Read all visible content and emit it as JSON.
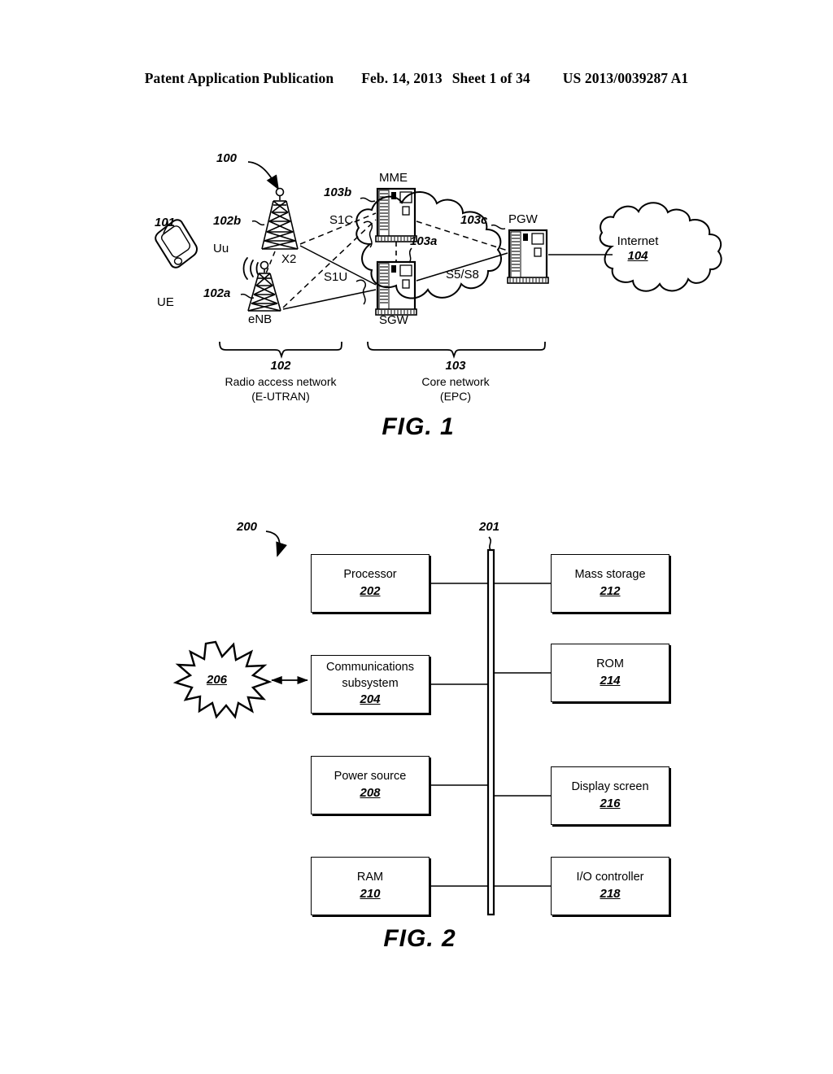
{
  "header": {
    "publication": "Patent Application Publication",
    "date": "Feb. 14, 2013",
    "sheet": "Sheet 1 of 34",
    "docnum": "US 2013/0039287 A1"
  },
  "fig1": {
    "caption": "FIG. 1",
    "system_ref": "100",
    "ue": {
      "ref": "101",
      "label": "UE"
    },
    "enb_a": {
      "ref": "102a"
    },
    "enb_b": {
      "ref": "102b"
    },
    "enb_label": "eNB",
    "interfaces": {
      "uu": "Uu",
      "x2": "X2",
      "s1c": "S1C",
      "s1u": "S1U",
      "s5s8": "S5/S8"
    },
    "nodes": [
      {
        "name": "MME",
        "ref": "103b"
      },
      {
        "name": "SGW",
        "ref": "103a"
      },
      {
        "name": "PGW",
        "ref": "103c"
      }
    ],
    "internet": {
      "label": "Internet",
      "ref": "104"
    },
    "groups": [
      {
        "num": "102",
        "line1": "Radio access network",
        "line2": "(E-UTRAN)"
      },
      {
        "num": "103",
        "line1": "Core network",
        "line2": "(EPC)"
      }
    ]
  },
  "fig2": {
    "caption": "FIG. 2",
    "system_ref": "200",
    "bus_ref": "201",
    "network_ref": "206",
    "left_blocks": [
      {
        "label": "Processor",
        "num": "202"
      },
      {
        "label": "Communications subsystem",
        "label1": "Communications",
        "label2": "subsystem",
        "num": "204"
      },
      {
        "label": "Power source",
        "num": "208"
      },
      {
        "label": "RAM",
        "num": "210"
      }
    ],
    "right_blocks": [
      {
        "label": "Mass storage",
        "num": "212"
      },
      {
        "label": "ROM",
        "num": "214"
      },
      {
        "label": "Display screen",
        "num": "216"
      },
      {
        "label": "I/O controller",
        "num": "218"
      }
    ]
  }
}
